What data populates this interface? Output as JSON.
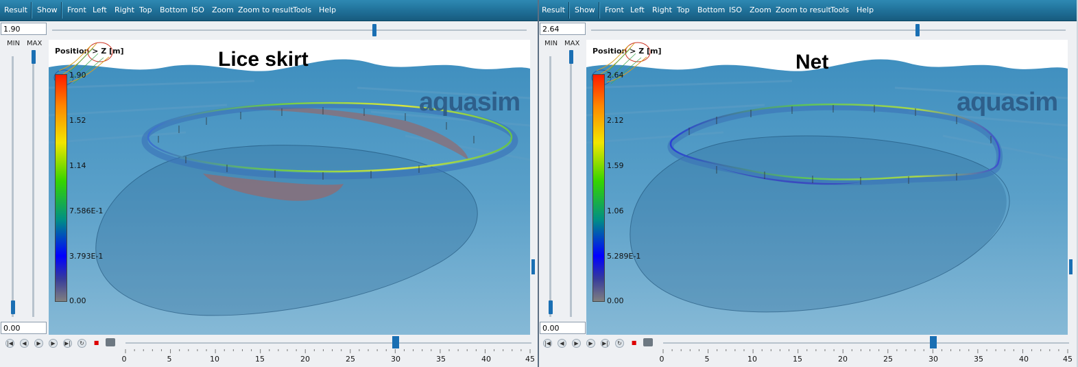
{
  "left": {
    "menu": [
      "Result",
      "Show",
      "Front",
      "Left",
      "Right",
      "Top",
      "Bottom",
      "ISO",
      "Zoom",
      "Zoom to result",
      "Tools",
      "Help"
    ],
    "max_value": "1.90",
    "min_value": "0.00",
    "min_label": "MIN",
    "max_label": "MAX",
    "viewport_label": "Position > Z [m]",
    "title": "Lice skirt",
    "logo": "aquasim",
    "legend_ticks": [
      "1.90",
      "1.52",
      "1.14",
      "7.586E-1",
      "3.793E-1",
      "0.00"
    ],
    "time_axis": [
      "0",
      "5",
      "10",
      "15",
      "20",
      "25",
      "30",
      "35",
      "40",
      "45"
    ],
    "time_value": 30
  },
  "right": {
    "menu": [
      "Result",
      "Show",
      "Front",
      "Left",
      "Right",
      "Top",
      "Bottom",
      "ISO",
      "Zoom",
      "Zoom to result",
      "Tools",
      "Help"
    ],
    "max_value": "2.64",
    "min_value": "0.00",
    "min_label": "MIN",
    "max_label": "MAX",
    "viewport_label": "Position > Z [m]",
    "title": "Net",
    "logo": "aquasim",
    "legend_ticks": [
      "2.64",
      "2.12",
      "1.59",
      "1.06",
      "5.289E-1",
      "0.00"
    ],
    "time_axis": [
      "0",
      "5",
      "10",
      "15",
      "20",
      "25",
      "30",
      "35",
      "40",
      "45"
    ],
    "time_value": 30
  },
  "playback_icons": [
    "skip-start-icon",
    "step-back-icon",
    "play-icon",
    "step-forward-icon",
    "skip-end-icon",
    "loop-icon",
    "record-icon",
    "camera-icon"
  ],
  "colors": {
    "accent": "#1a6fb3",
    "menubar": "#1f6f97",
    "water": "#4f97c4"
  }
}
